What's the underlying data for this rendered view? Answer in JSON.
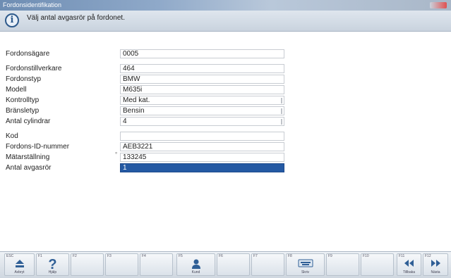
{
  "window": {
    "title": "Fordonsidentifikation"
  },
  "message": {
    "icon": "info-icon",
    "text": "Välj antal avgasrör på fordonet."
  },
  "form": {
    "rows": [
      {
        "label": "Fordonsägare",
        "value": "0005"
      },
      {
        "label": "Fordonstillverkare",
        "value": "464"
      },
      {
        "label": "Fordonstyp",
        "value": "BMW"
      },
      {
        "label": "Modell",
        "value": "M635i"
      },
      {
        "label": "Kontrolltyp",
        "value": "Med kat."
      },
      {
        "label": "Bränsletyp",
        "value": "Bensin"
      },
      {
        "label": "Antal cylindrar",
        "value": "4"
      },
      {
        "label": "Kod",
        "value": ""
      },
      {
        "label": "Fordons-ID-nummer",
        "value": "AEB3221"
      },
      {
        "label": "Mätarställning",
        "value": "133245"
      },
      {
        "label": "Antal avgasrör",
        "value": "1"
      }
    ]
  },
  "toolbar": {
    "keys": [
      {
        "num": "ESC",
        "caption": "Avbryt",
        "icon": "eject-icon"
      },
      {
        "num": "F1",
        "caption": "Hjälp",
        "icon": "help-icon"
      },
      {
        "num": "F2",
        "caption": "",
        "icon": ""
      },
      {
        "num": "F3",
        "caption": "",
        "icon": ""
      },
      {
        "num": "F4",
        "caption": "",
        "icon": ""
      },
      {
        "num": "F5",
        "caption": "Kund",
        "icon": "person-icon"
      },
      {
        "num": "F6",
        "caption": "",
        "icon": ""
      },
      {
        "num": "F7",
        "caption": "",
        "icon": ""
      },
      {
        "num": "F8",
        "caption": "Skriv",
        "icon": "keyboard-icon"
      },
      {
        "num": "F9",
        "caption": "",
        "icon": ""
      },
      {
        "num": "F10",
        "caption": "",
        "icon": ""
      },
      {
        "num": "F11",
        "caption": "Tillbaka",
        "icon": "back-icon"
      },
      {
        "num": "F12",
        "caption": "Nästa",
        "icon": "forward-icon"
      }
    ]
  }
}
